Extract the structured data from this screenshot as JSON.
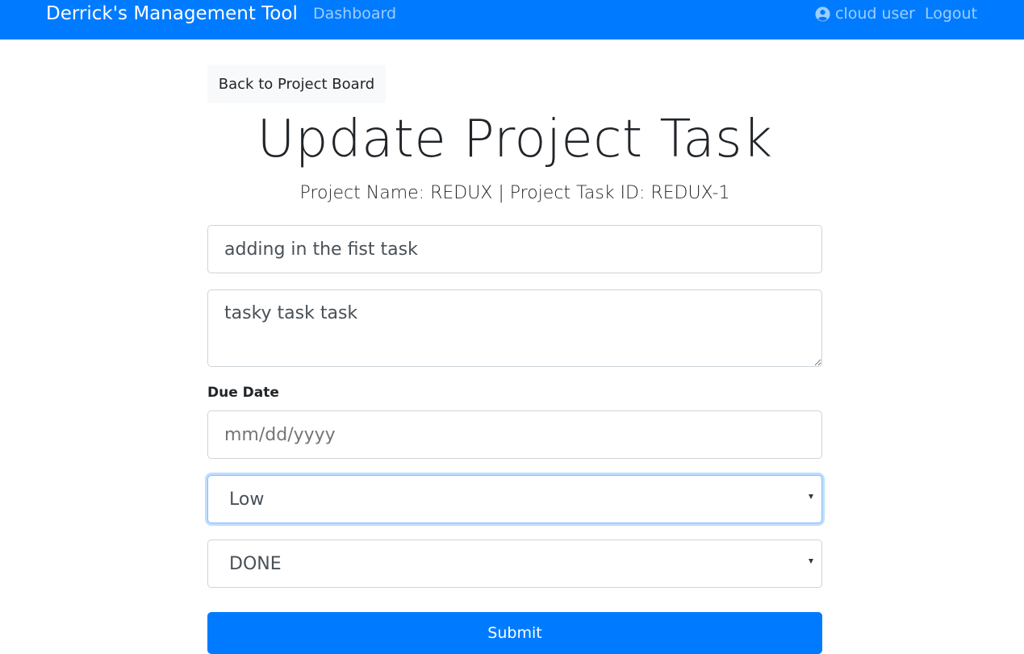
{
  "navbar": {
    "brand": "Derrick's Management Tool",
    "dashboard_label": "Dashboard",
    "user_label": "cloud user",
    "logout_label": "Logout",
    "color": "#007bff"
  },
  "back_button_label": "Back to Project Board",
  "page_title": "Update Project Task",
  "subtitle": "Project Name: REDUX | Project Task ID: REDUX-1",
  "form": {
    "summary_value": "adding in the fist task",
    "acceptance_criteria_value": "tasky task task",
    "due_date_label": "Due Date",
    "due_date_placeholder": "mm/dd/yyyy",
    "priority_selected": "Low",
    "status_selected": "DONE",
    "submit_label": "Submit"
  },
  "icons": {
    "user": "user-circle-icon",
    "select_caret": "chevron-down-icon"
  }
}
